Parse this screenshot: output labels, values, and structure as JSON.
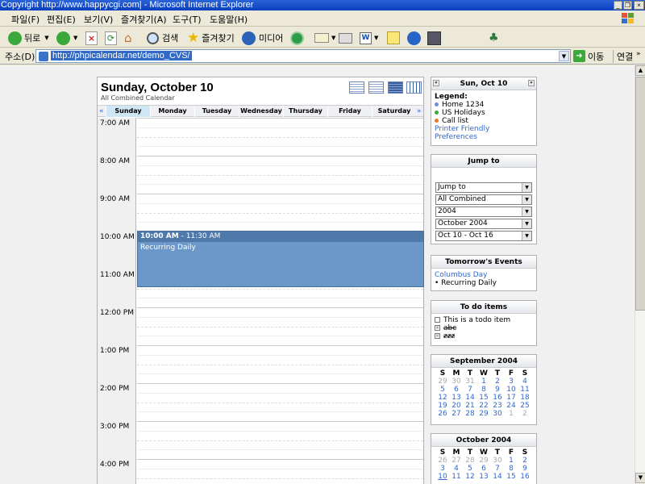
{
  "window": {
    "title": "Copyright   http://www.happycgi.com| - Microsoft Internet Explorer"
  },
  "menu": [
    "파일(F)",
    "편집(E)",
    "보기(V)",
    "즐겨찾기(A)",
    "도구(T)",
    "도움말(H)"
  ],
  "toolbar": {
    "back": "뒤로",
    "search": "검색",
    "favorites": "즐겨찾기",
    "media": "미디어"
  },
  "address": {
    "label": "주소(D)",
    "url": "http://phpicalendar.net/demo_CVS/",
    "go": "이동",
    "links": "연결"
  },
  "calendar": {
    "title": "Sunday, October 10",
    "subtitle": "All Combined Calendar",
    "prev": "«",
    "next": "»",
    "days": [
      "Sunday",
      "Monday",
      "Tuesday",
      "Wednesday",
      "Thursday",
      "Friday",
      "Saturday"
    ],
    "hours": [
      "7:00 AM",
      "8:00 AM",
      "9:00 AM",
      "10:00 AM",
      "11:00 AM",
      "12:00 PM",
      "1:00 PM",
      "2:00 PM",
      "3:00 PM",
      "4:00 PM"
    ],
    "event": {
      "start": "10:00 AM",
      "sep": " - ",
      "end": "11:30 AM",
      "title": "Recurring Daily"
    }
  },
  "mini_day": {
    "title": "Sun, Oct 10",
    "legend_label": "Legend:",
    "legend": [
      {
        "name": "Home 1234",
        "color": "#6b8fd6"
      },
      {
        "name": "US Holidays",
        "color": "#33aa33"
      },
      {
        "name": "Call list",
        "color": "#ee7722"
      }
    ],
    "printer": "Printer Friendly",
    "prefs": "Preferences"
  },
  "jump": {
    "title": "Jump to",
    "selects": [
      "Jump to",
      "All Combined",
      "2004",
      "October 2004",
      "Oct 10 - Oct 16"
    ]
  },
  "tomorrow": {
    "title": "Tomorrow's Events",
    "holiday": "Columbus Day",
    "event": "• Recurring Daily"
  },
  "todo": {
    "title": "To do items",
    "items": [
      {
        "text": "This is a todo item",
        "done": false
      },
      {
        "text": "abc",
        "done": true
      },
      {
        "text": "zzz",
        "done": true
      }
    ]
  },
  "sept": {
    "title": "September 2004",
    "weekdays": [
      "S",
      "M",
      "T",
      "W",
      "T",
      "F",
      "S"
    ],
    "weeks": [
      [
        "29",
        "30",
        "31",
        "1",
        "2",
        "3",
        "4"
      ],
      [
        "5",
        "6",
        "7",
        "8",
        "9",
        "10",
        "11"
      ],
      [
        "12",
        "13",
        "14",
        "15",
        "16",
        "17",
        "18"
      ],
      [
        "19",
        "20",
        "21",
        "22",
        "23",
        "24",
        "25"
      ],
      [
        "26",
        "27",
        "28",
        "29",
        "30",
        "1",
        "2"
      ]
    ]
  },
  "oct": {
    "title": "October 2004",
    "weekdays": [
      "S",
      "M",
      "T",
      "W",
      "T",
      "F",
      "S"
    ],
    "weeks": [
      [
        "26",
        "27",
        "28",
        "29",
        "30",
        "1",
        "2"
      ],
      [
        "3",
        "4",
        "5",
        "6",
        "7",
        "8",
        "9"
      ],
      [
        "10",
        "11",
        "12",
        "13",
        "14",
        "15",
        "16"
      ]
    ]
  }
}
